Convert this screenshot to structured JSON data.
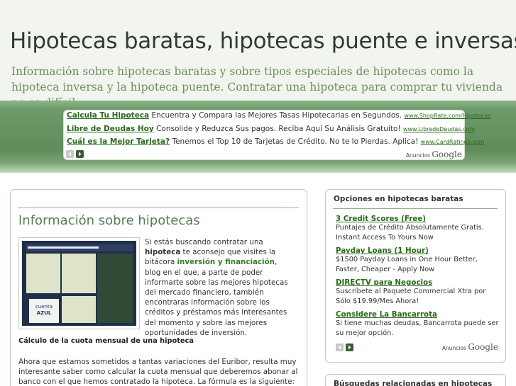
{
  "header": {
    "title": "Hipotecas baratas, hipotecas puente e inversas",
    "description": "Información sobre hipotecas baratas y sobre tipos especiales de hipotecas como la hipoteca inversa y la hipoteca puente. Contratar una hipoteca para comprar tu vivienda no es difícil."
  },
  "top_ads": {
    "items": [
      {
        "title": "Calcula Tu Hipoteca",
        "text": "Encuentra y Compara las Mejores Tasas Hipotecarias en Segundos.",
        "url": "www.ShopRate.com/Hipotecas"
      },
      {
        "title": "Libre de Deudas Hoy",
        "text": "Consolide y Reduzca Sus pagos. Reciba Aquí Su Análisis Gratuito!",
        "url": "www.LibredeDeudas.com"
      },
      {
        "title": "Cuál es la Mejor Tarjeta?",
        "text": "Tenemos el Top 10 de Tarjetas de Crédito. No te lo Pierdas. Aplica!",
        "url": "www.CardRatings.com"
      }
    ],
    "ads_by_label": "Anuncios",
    "ads_by_brand": "Google"
  },
  "post": {
    "title": "Información sobre hipotecas",
    "thumb_logo_line1": "cuenta",
    "thumb_logo_line2": "AZUL",
    "intro_1": "Si estás buscando contratar una ",
    "intro_kw1": "hipoteca",
    "intro_2": " te aconsejo que visites la bitácora ",
    "intro_link": "inversión y financiación",
    "intro_3": ", blog en el que, a parte de poder informarte sobre las mejores hipotecas del mercado financiero, también encontraras información sobre los créditos y préstamos más interesantes del momento y sobre las mejores oportunidades de inversión.",
    "subheading": "Cálculo de la cuota mensual de una hipoteca",
    "paragraph": "Ahora que estamos sometidos a tantas variaciones del Euribor, resulta muy interesante saber como calcular la cuota mensual que deberemos abonar al banco con el que hemos contratado la hipoteca. La fórmula es la siguiente:"
  },
  "sidebar": {
    "title": "Opciones en hipotecas baratas",
    "ads": [
      {
        "title": "3 Credit Scores (Free)",
        "text": "Puntajes de Crédito Absolutamente Gratis. Instant Access To Yours Now"
      },
      {
        "title": "Payday Loans (1 Hour)",
        "text": "$1500 Payday Loans in One Hour Better, Faster, Cheaper - Apply Now"
      },
      {
        "title": "DIRECTV para Negocios",
        "text": "Suscríbete al Paquete Commercial Xtra por Sólo $19.99/Mes Ahora!"
      },
      {
        "title": "Considere La Bancarrota",
        "text": "Si tiene muchas deudas, Bancarrota puede ser su mejor opción."
      }
    ],
    "ads_by_label": "Anuncios",
    "ads_by_brand": "Google",
    "related_title": "Búsquedas relacionadas en hipotecas"
  }
}
